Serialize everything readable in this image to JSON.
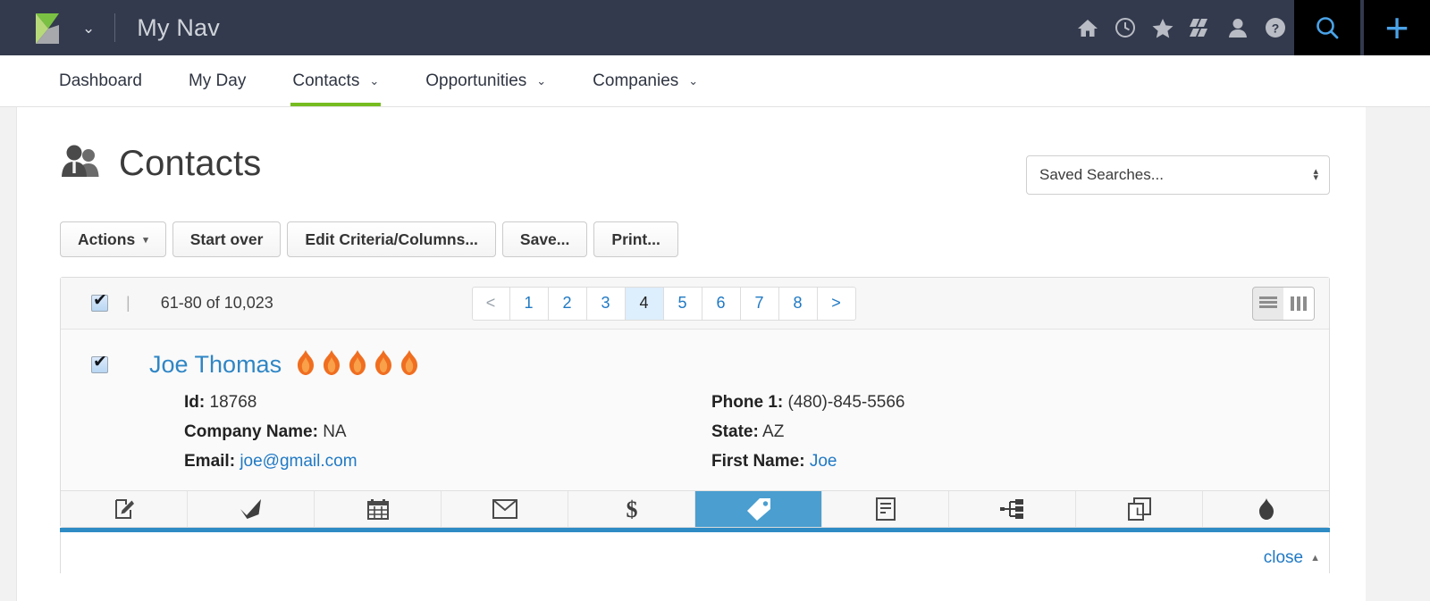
{
  "topbar": {
    "logo_icon": "sharpspring-logo-icon",
    "logo_caret_icon": "chevron-down-icon",
    "nav_title": "My Nav",
    "icons": [
      {
        "name": "home-icon",
        "glyph": "home"
      },
      {
        "name": "clock-icon",
        "glyph": "clock"
      },
      {
        "name": "star-icon",
        "glyph": "star"
      },
      {
        "name": "stripes-icon",
        "glyph": "stripes"
      },
      {
        "name": "user-icon",
        "glyph": "user"
      },
      {
        "name": "help-icon",
        "glyph": "help"
      }
    ],
    "search_icon": "search-icon",
    "add_icon": "plus-icon",
    "add_glyph": "+"
  },
  "mainnav": {
    "items": [
      {
        "label": "Dashboard",
        "has_caret": false,
        "active": false
      },
      {
        "label": "My Day",
        "has_caret": false,
        "active": false
      },
      {
        "label": "Contacts",
        "has_caret": true,
        "active": true
      },
      {
        "label": "Opportunities",
        "has_caret": true,
        "active": false
      },
      {
        "label": "Companies",
        "has_caret": true,
        "active": false
      }
    ],
    "caret_glyph": "⌄",
    "active_color": "#76bc21"
  },
  "page": {
    "title": "Contacts",
    "title_icon": "contacts-people-icon",
    "saved_search": {
      "value": "Saved Searches...",
      "spinner_icon": "stepper-updown-icon"
    },
    "buttons": [
      {
        "label": "Actions",
        "caret": true
      },
      {
        "label": "Start over",
        "caret": false
      },
      {
        "label": "Edit Criteria/Columns...",
        "caret": false
      },
      {
        "label": "Save...",
        "caret": false
      },
      {
        "label": "Print...",
        "caret": false
      }
    ],
    "caret_glyph": "▾"
  },
  "results": {
    "select_all_checked": true,
    "divider": "|",
    "count_label": "61-80 of 10,023",
    "pager": [
      {
        "label": "<",
        "current": false,
        "nav": true
      },
      {
        "label": "1",
        "current": false,
        "nav": false
      },
      {
        "label": "2",
        "current": false,
        "nav": false
      },
      {
        "label": "3",
        "current": false,
        "nav": false
      },
      {
        "label": "4",
        "current": true,
        "nav": false
      },
      {
        "label": "5",
        "current": false,
        "nav": false
      },
      {
        "label": "6",
        "current": false,
        "nav": false
      },
      {
        "label": "7",
        "current": false,
        "nav": false
      },
      {
        "label": "8",
        "current": false,
        "nav": false
      },
      {
        "label": ">",
        "current": false,
        "nav": true
      }
    ],
    "view_toggle": {
      "list_icon": "list-view-icon",
      "column_icon": "column-view-icon",
      "active": "column-view-icon"
    }
  },
  "record": {
    "checked": true,
    "name": "Joe Thomas",
    "rating_icon": "flame-icon",
    "rating_count": 5,
    "fields_left": [
      {
        "label": "Id:",
        "value": "18768",
        "link": false
      },
      {
        "label": "Company Name:",
        "value": "NA",
        "link": false
      },
      {
        "label": "Email:",
        "value": "joe@gmail.com",
        "link": true
      }
    ],
    "fields_right": [
      {
        "label": "Phone 1:",
        "value": "(480)-845-5566",
        "link": false
      },
      {
        "label": "State:",
        "value": "AZ",
        "link": false
      },
      {
        "label": "First Name:",
        "value": "Joe",
        "link": true
      }
    ]
  },
  "action_toolbar": {
    "items": [
      {
        "name": "edit-note-icon",
        "active": false
      },
      {
        "name": "checkmark-icon",
        "active": false
      },
      {
        "name": "calendar-icon",
        "active": false
      },
      {
        "name": "envelope-icon",
        "active": false
      },
      {
        "name": "dollar-icon",
        "active": false
      },
      {
        "name": "tag-icon",
        "active": true
      },
      {
        "name": "document-icon",
        "active": false
      },
      {
        "name": "sitemap-icon",
        "active": false
      },
      {
        "name": "duplicate-icon",
        "active": false
      },
      {
        "name": "flame-icon",
        "active": false
      }
    ],
    "accent_color": "#4a9ed0"
  },
  "footer": {
    "close_label": "close",
    "close_caret_icon": "caret-up-icon",
    "close_caret_glyph": "▲"
  }
}
